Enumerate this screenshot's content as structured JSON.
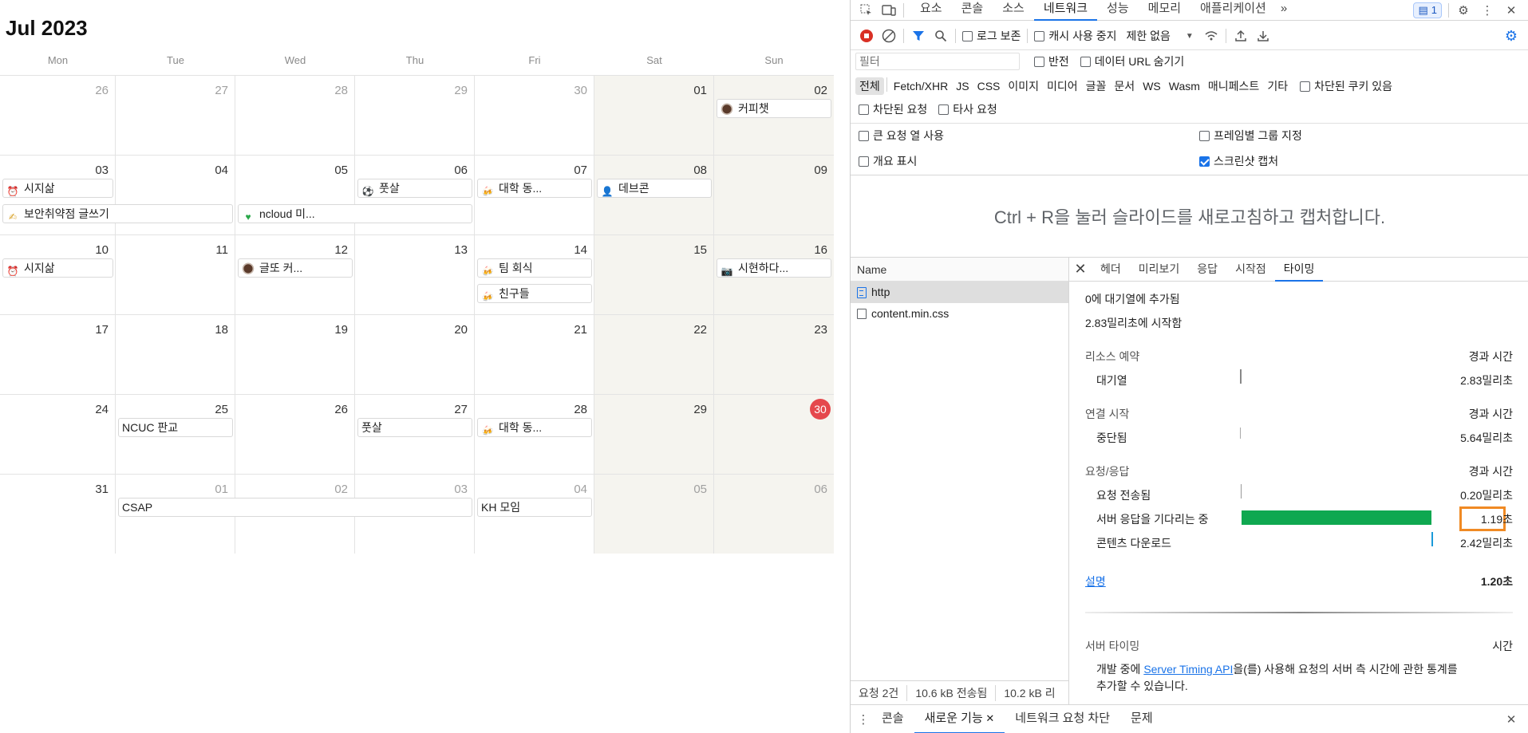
{
  "calendar": {
    "title": "Jul 2023",
    "weekdays": [
      "Mon",
      "Tue",
      "Wed",
      "Thu",
      "Fri",
      "Sat",
      "Sun"
    ],
    "weeks": [
      [
        "26",
        "27",
        "28",
        "29",
        "30",
        "01",
        "02"
      ],
      [
        "03",
        "04",
        "05",
        "06",
        "07",
        "08",
        "09"
      ],
      [
        "10",
        "11",
        "12",
        "13",
        "14",
        "15",
        "16"
      ],
      [
        "17",
        "18",
        "19",
        "20",
        "21",
        "22",
        "23"
      ],
      [
        "24",
        "25",
        "26",
        "27",
        "28",
        "29",
        "30"
      ],
      [
        "31",
        "01",
        "02",
        "03",
        "04",
        "05",
        "06"
      ]
    ],
    "today": "30",
    "events": {
      "coffee_chat": "커피챗",
      "sijisal_1": "시지삶",
      "security_writing": "보안취약점 글쓰기",
      "ncloud": "ncloud 미...",
      "futsal_1": "풋살",
      "univ_1": "대학 동...",
      "devcon": "데브콘",
      "sijisal_2": "시지삶",
      "geulto": "글또 커...",
      "team_dinner": "팀 회식",
      "friends": "친구들",
      "sihyun": "시현하다...",
      "ncuc": "NCUC 판교",
      "futsal_2": "풋살",
      "univ_2": "대학 동...",
      "csap": "CSAP",
      "kh": "KH 모임"
    }
  },
  "devtools": {
    "tabs": [
      "요소",
      "콘솔",
      "소스",
      "네트워크",
      "성능",
      "메모리",
      "애플리케이션"
    ],
    "active_tab": "네트워크",
    "more": "»",
    "issues_badge": "1",
    "toolbar": {
      "preserve_log": "로그 보존",
      "disable_cache": "캐시 사용 중지",
      "throttle": "제한 없음"
    },
    "filter": {
      "placeholder": "필터",
      "invert": "반전",
      "hide_data_urls": "데이터 URL 숨기기"
    },
    "types": [
      "전체",
      "Fetch/XHR",
      "JS",
      "CSS",
      "이미지",
      "미디어",
      "글꼴",
      "문서",
      "WS",
      "Wasm",
      "매니페스트",
      "기타"
    ],
    "blocked_cookies": "차단된 쿠키 있음",
    "blocked_requests": "차단된 요청",
    "third_party": "타사 요청",
    "options": {
      "big_rows": "큰 요청 열 사용",
      "group_by_frame": "프레임별 그룹 지정",
      "overview": "개요 표시",
      "capture_screenshots": "스크린샷 캡처"
    },
    "screenshot_hint": "Ctrl + R을 눌러 슬라이드를 새로고침하고 캡처합니다.",
    "name_header": "Name",
    "requests": [
      "http",
      "content.min.css"
    ],
    "footer": {
      "count": "요청 2건",
      "transferred": "10.6 kB 전송됨",
      "resources": "10.2 kB 리"
    },
    "detail_tabs": [
      "헤더",
      "미리보기",
      "응답",
      "시작점",
      "타이밍"
    ],
    "active_detail_tab": "타이밍",
    "timing": {
      "queued_at": "0에 대기열에 추가됨",
      "started_at": "2.83밀리초에 시작함",
      "resource_scheduling": "리소스 예약",
      "duration_label": "경과 시간",
      "queueing": "대기열",
      "queueing_time": "2.83밀리초",
      "connection_start": "연결 시작",
      "stalled": "중단됨",
      "stalled_time": "5.64밀리초",
      "request_response": "요청/응답",
      "request_sent": "요청 전송됨",
      "request_sent_time": "0.20밀리초",
      "waiting": "서버 응답을 기다리는 중",
      "waiting_time": "1.19초",
      "content_download": "콘텐츠 다운로드",
      "content_download_time": "2.42밀리초",
      "explanation": "설명",
      "total": "1.20초",
      "server_timing": "서버 타이밍",
      "time_label": "시간",
      "server_timing_pre": "개발 중에 ",
      "server_timing_link": "Server Timing API",
      "server_timing_post": "을(를) 사용해 요청의 서버 측 시간에 관한 통계를",
      "server_timing_post2": "추가할 수 있습니다."
    },
    "drawer": {
      "tabs": [
        "콘솔",
        "새로운 기능",
        "네트워크 요청 차단",
        "문제"
      ],
      "active": "새로운 기능"
    },
    "colors": {
      "accent": "#1a73e8",
      "waiting_bar": "#0fa850",
      "record": "#d93025",
      "highlight": "#f08a24",
      "today": "#e5484d"
    }
  }
}
